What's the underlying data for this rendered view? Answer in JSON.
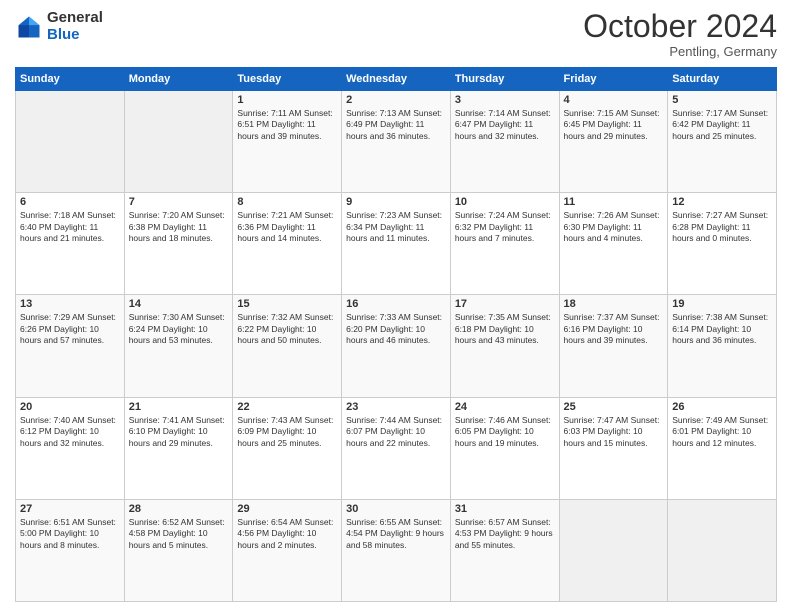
{
  "header": {
    "logo_general": "General",
    "logo_blue": "Blue",
    "title": "October 2024",
    "location": "Pentling, Germany"
  },
  "days_of_week": [
    "Sunday",
    "Monday",
    "Tuesday",
    "Wednesday",
    "Thursday",
    "Friday",
    "Saturday"
  ],
  "weeks": [
    [
      {
        "day": "",
        "info": ""
      },
      {
        "day": "",
        "info": ""
      },
      {
        "day": "1",
        "info": "Sunrise: 7:11 AM\nSunset: 6:51 PM\nDaylight: 11 hours and 39 minutes."
      },
      {
        "day": "2",
        "info": "Sunrise: 7:13 AM\nSunset: 6:49 PM\nDaylight: 11 hours and 36 minutes."
      },
      {
        "day": "3",
        "info": "Sunrise: 7:14 AM\nSunset: 6:47 PM\nDaylight: 11 hours and 32 minutes."
      },
      {
        "day": "4",
        "info": "Sunrise: 7:15 AM\nSunset: 6:45 PM\nDaylight: 11 hours and 29 minutes."
      },
      {
        "day": "5",
        "info": "Sunrise: 7:17 AM\nSunset: 6:42 PM\nDaylight: 11 hours and 25 minutes."
      }
    ],
    [
      {
        "day": "6",
        "info": "Sunrise: 7:18 AM\nSunset: 6:40 PM\nDaylight: 11 hours and 21 minutes."
      },
      {
        "day": "7",
        "info": "Sunrise: 7:20 AM\nSunset: 6:38 PM\nDaylight: 11 hours and 18 minutes."
      },
      {
        "day": "8",
        "info": "Sunrise: 7:21 AM\nSunset: 6:36 PM\nDaylight: 11 hours and 14 minutes."
      },
      {
        "day": "9",
        "info": "Sunrise: 7:23 AM\nSunset: 6:34 PM\nDaylight: 11 hours and 11 minutes."
      },
      {
        "day": "10",
        "info": "Sunrise: 7:24 AM\nSunset: 6:32 PM\nDaylight: 11 hours and 7 minutes."
      },
      {
        "day": "11",
        "info": "Sunrise: 7:26 AM\nSunset: 6:30 PM\nDaylight: 11 hours and 4 minutes."
      },
      {
        "day": "12",
        "info": "Sunrise: 7:27 AM\nSunset: 6:28 PM\nDaylight: 11 hours and 0 minutes."
      }
    ],
    [
      {
        "day": "13",
        "info": "Sunrise: 7:29 AM\nSunset: 6:26 PM\nDaylight: 10 hours and 57 minutes."
      },
      {
        "day": "14",
        "info": "Sunrise: 7:30 AM\nSunset: 6:24 PM\nDaylight: 10 hours and 53 minutes."
      },
      {
        "day": "15",
        "info": "Sunrise: 7:32 AM\nSunset: 6:22 PM\nDaylight: 10 hours and 50 minutes."
      },
      {
        "day": "16",
        "info": "Sunrise: 7:33 AM\nSunset: 6:20 PM\nDaylight: 10 hours and 46 minutes."
      },
      {
        "day": "17",
        "info": "Sunrise: 7:35 AM\nSunset: 6:18 PM\nDaylight: 10 hours and 43 minutes."
      },
      {
        "day": "18",
        "info": "Sunrise: 7:37 AM\nSunset: 6:16 PM\nDaylight: 10 hours and 39 minutes."
      },
      {
        "day": "19",
        "info": "Sunrise: 7:38 AM\nSunset: 6:14 PM\nDaylight: 10 hours and 36 minutes."
      }
    ],
    [
      {
        "day": "20",
        "info": "Sunrise: 7:40 AM\nSunset: 6:12 PM\nDaylight: 10 hours and 32 minutes."
      },
      {
        "day": "21",
        "info": "Sunrise: 7:41 AM\nSunset: 6:10 PM\nDaylight: 10 hours and 29 minutes."
      },
      {
        "day": "22",
        "info": "Sunrise: 7:43 AM\nSunset: 6:09 PM\nDaylight: 10 hours and 25 minutes."
      },
      {
        "day": "23",
        "info": "Sunrise: 7:44 AM\nSunset: 6:07 PM\nDaylight: 10 hours and 22 minutes."
      },
      {
        "day": "24",
        "info": "Sunrise: 7:46 AM\nSunset: 6:05 PM\nDaylight: 10 hours and 19 minutes."
      },
      {
        "day": "25",
        "info": "Sunrise: 7:47 AM\nSunset: 6:03 PM\nDaylight: 10 hours and 15 minutes."
      },
      {
        "day": "26",
        "info": "Sunrise: 7:49 AM\nSunset: 6:01 PM\nDaylight: 10 hours and 12 minutes."
      }
    ],
    [
      {
        "day": "27",
        "info": "Sunrise: 6:51 AM\nSunset: 5:00 PM\nDaylight: 10 hours and 8 minutes."
      },
      {
        "day": "28",
        "info": "Sunrise: 6:52 AM\nSunset: 4:58 PM\nDaylight: 10 hours and 5 minutes."
      },
      {
        "day": "29",
        "info": "Sunrise: 6:54 AM\nSunset: 4:56 PM\nDaylight: 10 hours and 2 minutes."
      },
      {
        "day": "30",
        "info": "Sunrise: 6:55 AM\nSunset: 4:54 PM\nDaylight: 9 hours and 58 minutes."
      },
      {
        "day": "31",
        "info": "Sunrise: 6:57 AM\nSunset: 4:53 PM\nDaylight: 9 hours and 55 minutes."
      },
      {
        "day": "",
        "info": ""
      },
      {
        "day": "",
        "info": ""
      }
    ]
  ]
}
